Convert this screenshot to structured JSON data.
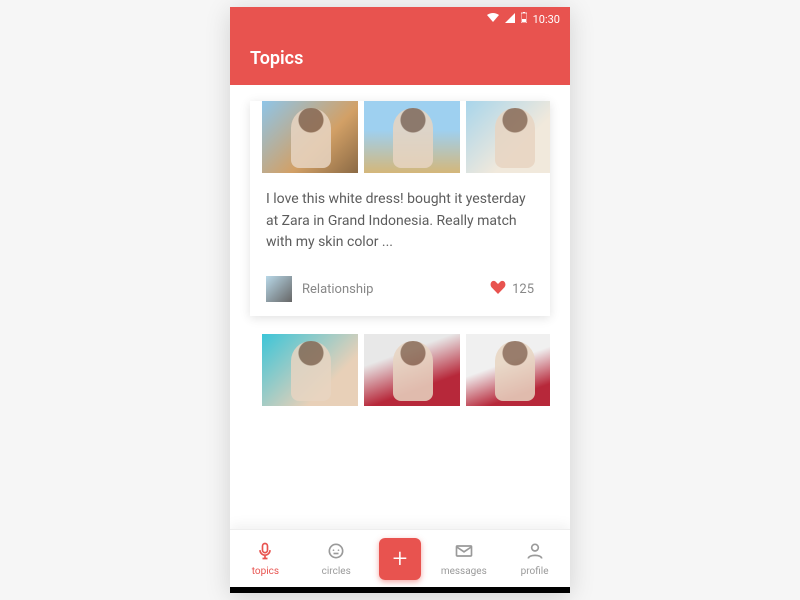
{
  "status": {
    "time": "10:30"
  },
  "header": {
    "title": "Topics"
  },
  "feed": {
    "posts": [
      {
        "caption": "I love this white dress! bought it yesterday at Zara in Grand Indonesia. Really match with my skin color ...",
        "category": "Relationship",
        "likes": "125"
      }
    ]
  },
  "nav": {
    "items": [
      {
        "label": "topics"
      },
      {
        "label": "circles"
      },
      {
        "label": "messages"
      },
      {
        "label": "profile"
      }
    ]
  }
}
